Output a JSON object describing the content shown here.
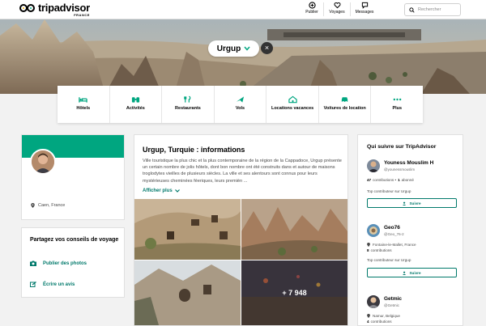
{
  "header": {
    "brand": "tripadvisor",
    "brand_sub": "FRANCE",
    "nav": [
      {
        "label": "Publier",
        "icon": "plus-circle-icon"
      },
      {
        "label": "Voyages",
        "icon": "heart-icon"
      },
      {
        "label": "Messages",
        "icon": "chat-icon"
      }
    ],
    "search_placeholder": "Rechercher"
  },
  "hero": {
    "city": "Urgup",
    "close_symbol": "×"
  },
  "categories": [
    {
      "label": "Hôtels",
      "icon": "bed-icon"
    },
    {
      "label": "Activités",
      "icon": "binoculars-icon"
    },
    {
      "label": "Restaurants",
      "icon": "fork-knife-icon"
    },
    {
      "label": "Vols",
      "icon": "plane-icon"
    },
    {
      "label": "Locations vacances",
      "icon": "house-icon"
    },
    {
      "label": "Voitures de location",
      "icon": "car-icon"
    },
    {
      "label": "Plus",
      "icon": "dots-icon"
    }
  ],
  "profile": {
    "location": "Caen, France"
  },
  "share": {
    "title": "Partagez vos conseils de voyage",
    "links": [
      {
        "label": "Publier des photos",
        "icon": "camera-icon"
      },
      {
        "label": "Écrire un avis",
        "icon": "edit-icon"
      }
    ]
  },
  "info": {
    "title": "Urgup, Turquie : informations",
    "description": "Ville touristique la plus chic et la plus contemporaine de la région de la Cappadoce, Urgup présente un certain nombre de jolis hôtels, dont bon nombre ont été construits dans et autour de maisons troglodytes vieilles de plusieurs siècles. La ville et ses alentours sont connus pour leurs mystérieuses cheminées féeriques, leurs premièn ...",
    "more_label": "Afficher plus",
    "photo_count": "+ 7 948"
  },
  "follow": {
    "title": "Qui suivre sur TripAdvisor",
    "button_label": "Suivre",
    "people": [
      {
        "name": "Youness Mouslim H",
        "handle": "@younessmouslim",
        "stats_num": "47",
        "stats_text": "contributions • ",
        "stats_num2": "1",
        "stats_text2": "abonné",
        "location": "",
        "top": "Top contributeur sur Urgup"
      },
      {
        "name": "Geo76",
        "handle": "@Geo_76-2",
        "stats_num": "8",
        "stats_text": "contributions",
        "location": "Fontaine-le-Mallet, France",
        "top": "Top contributeur sur Urgup"
      },
      {
        "name": "Getmic",
        "handle": "@Getmic",
        "stats_num": "4",
        "stats_text": "contributions",
        "location": "Namur, Belgique",
        "top": ""
      }
    ]
  },
  "colors": {
    "brand_green": "#00a680",
    "link_green": "#00796b"
  }
}
